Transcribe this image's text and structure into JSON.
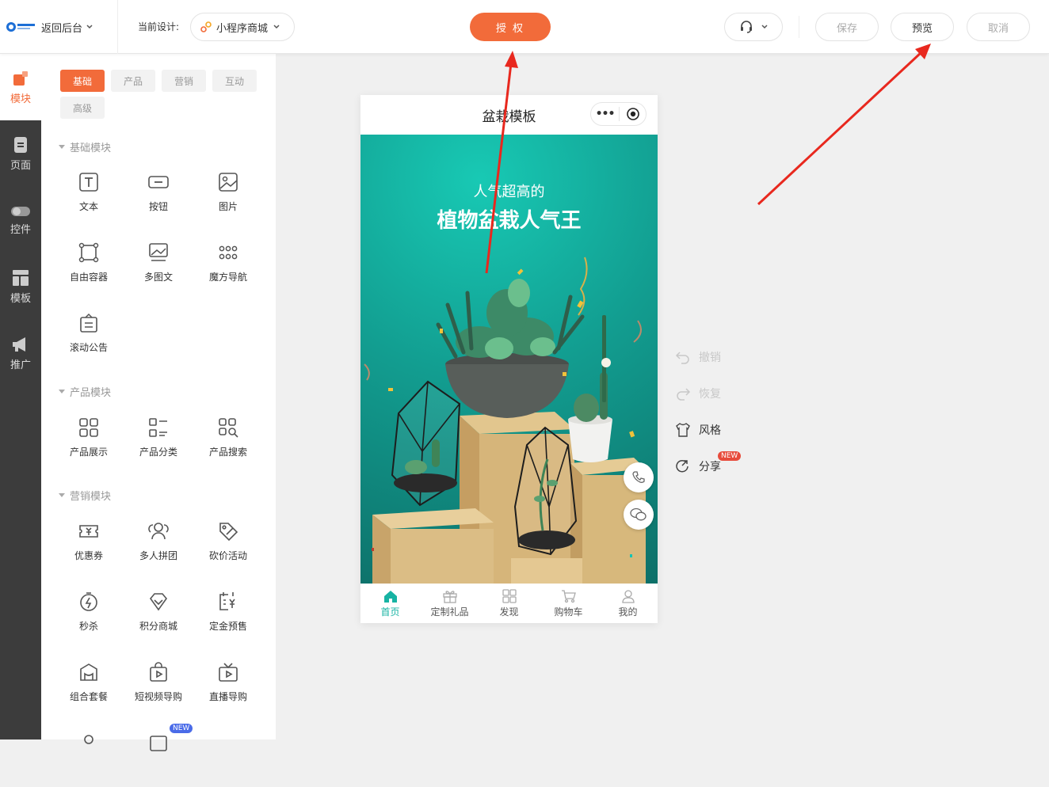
{
  "topbar": {
    "back_label": "返回后台",
    "current_design_label": "当前设计:",
    "design_name": "小程序商城",
    "auth_label": "授 权",
    "save_label": "保存",
    "preview_label": "预览",
    "cancel_label": "取消"
  },
  "iconbar": {
    "items": [
      {
        "label": "模块",
        "icon": "module-icon"
      },
      {
        "label": "页面",
        "icon": "page-icon"
      },
      {
        "label": "控件",
        "icon": "toggle-icon"
      },
      {
        "label": "模板",
        "icon": "template-icon"
      },
      {
        "label": "推广",
        "icon": "megaphone-icon"
      }
    ]
  },
  "panel": {
    "tabs": [
      "基础",
      "产品",
      "营销",
      "互动",
      "高级"
    ],
    "sections": [
      {
        "title": "基础模块",
        "items": [
          "文本",
          "按钮",
          "图片",
          "自由容器",
          "多图文",
          "魔方导航",
          "滚动公告"
        ]
      },
      {
        "title": "产品模块",
        "items": [
          "产品展示",
          "产品分类",
          "产品搜索"
        ]
      },
      {
        "title": "营销模块",
        "items": [
          "优惠券",
          "多人拼团",
          "砍价活动",
          "秒杀",
          "积分商城",
          "定金预售",
          "组合套餐",
          "短视频导购",
          "直播导购"
        ]
      }
    ],
    "new_badge": "NEW"
  },
  "phone": {
    "title": "盆栽模板",
    "banner_sub": "人气超高的",
    "banner_title": "植物盆栽人气王",
    "tabbar": [
      "首页",
      "定制礼品",
      "发现",
      "购物车",
      "我的"
    ]
  },
  "side_tools": {
    "undo": "撤销",
    "redo": "恢复",
    "style": "风格",
    "share": "分享",
    "new_badge": "NEW"
  },
  "colors": {
    "accent": "#f26b3a",
    "teal": "#17b3a3",
    "sidebar": "#3c3c3c",
    "annotation_arrow": "#e8281e"
  }
}
